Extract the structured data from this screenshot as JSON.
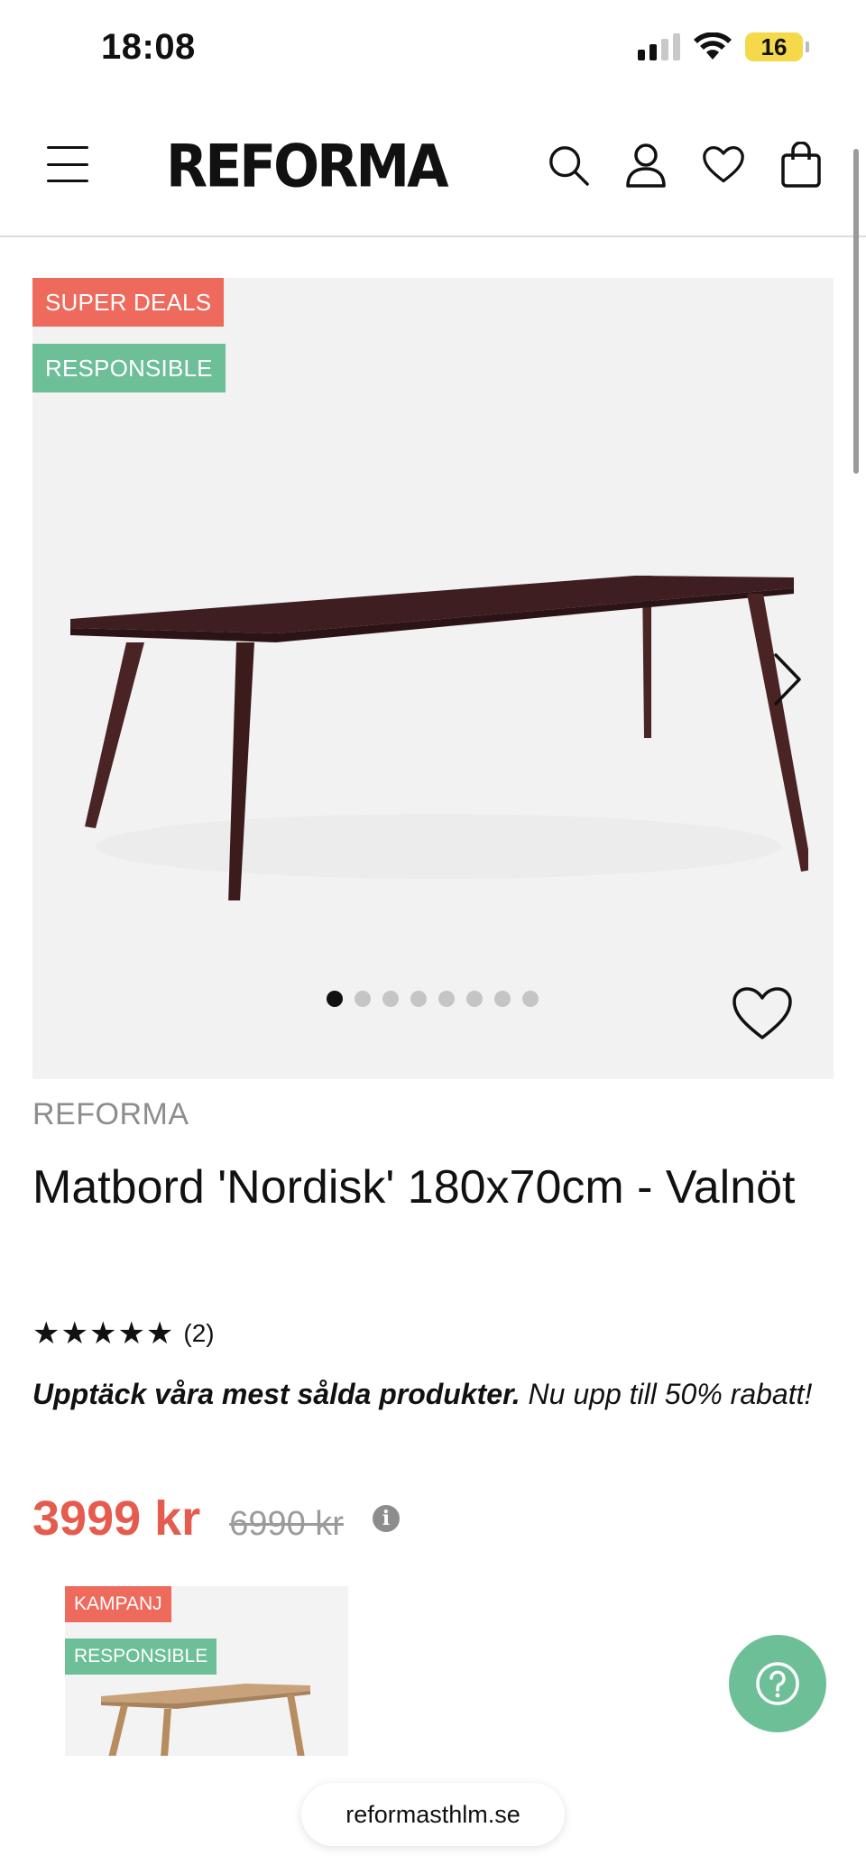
{
  "status_bar": {
    "time": "18:08",
    "battery": "16",
    "icons": [
      "signal-icon",
      "wifi-icon",
      "battery-icon"
    ]
  },
  "header": {
    "logo": "REFORMA",
    "icons": [
      "menu-icon",
      "search-icon",
      "account-icon",
      "wishlist-icon",
      "cart-icon"
    ]
  },
  "gallery": {
    "badges": [
      "SUPER DEALS",
      "RESPONSIBLE"
    ],
    "image_count": 8,
    "active_index": 0,
    "colors": {
      "super_deals": "#ee6a5c",
      "responsible": "#6dbf98"
    }
  },
  "product": {
    "brand": "REFORMA",
    "title": "Matbord 'Nordisk' 180x70cm - Valnöt",
    "stars": "★★★★★",
    "review_count": "(2)",
    "promo_bold": "Upptäck våra mest sålda produkter.",
    "promo_rest": " Nu upp till 50% rabatt!",
    "price": "3999 kr",
    "old_price": "6990 kr",
    "price_color": "#e55c4f"
  },
  "related": {
    "badges": [
      "KAMPANJ",
      "RESPONSIBLE"
    ]
  },
  "browser": {
    "url": "reformasthlm.se"
  }
}
